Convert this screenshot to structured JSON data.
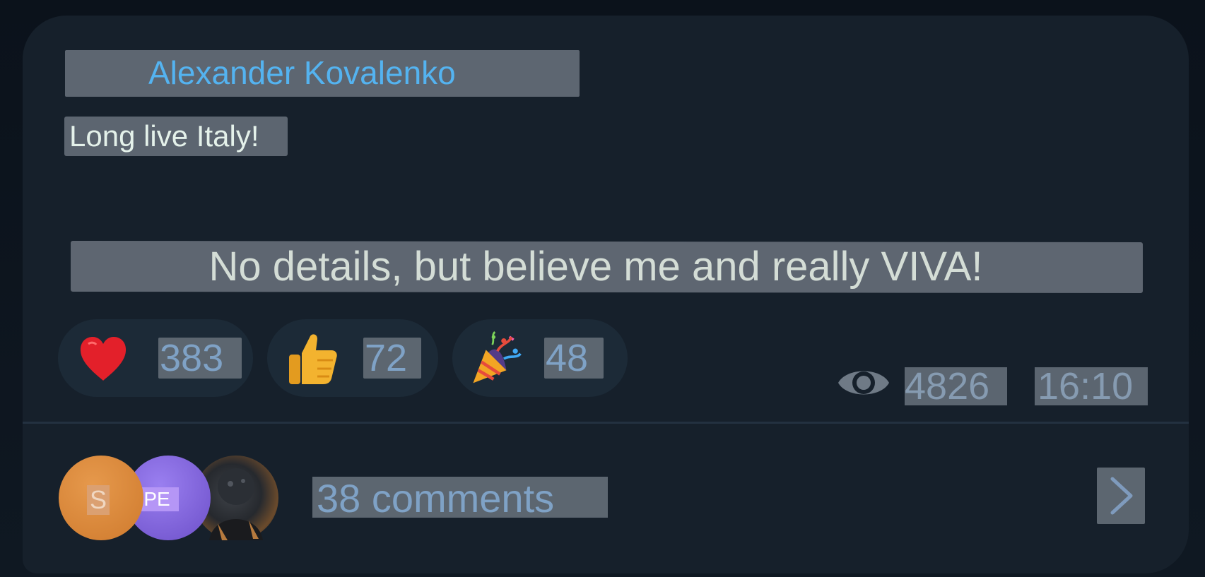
{
  "post": {
    "author": "Alexander Kovalenko",
    "message": "Long live Italy!",
    "detail": "No details, but believe me and really VIVA!"
  },
  "reactions": [
    {
      "icon": "heart-icon",
      "emoji": "❤",
      "count": "383"
    },
    {
      "icon": "thumbs-up-icon",
      "emoji": "👍",
      "count": "72"
    },
    {
      "icon": "party-popper-icon",
      "emoji": "🎉",
      "count": "48"
    }
  ],
  "meta": {
    "views_icon": "eye-icon",
    "views": "4826",
    "time": "16:10"
  },
  "comments": {
    "label": "38 comments",
    "avatars": [
      {
        "initials": "S",
        "color": "#d9853a"
      },
      {
        "initials": "PE",
        "color": "#8166e0"
      },
      {
        "initials": "",
        "color": "#3b3f45"
      }
    ],
    "open_icon": "chevron-right-icon"
  },
  "colors": {
    "accent": "#54b3f0",
    "bubble": "#16202b",
    "reaction_bg": "#1c2a37"
  }
}
